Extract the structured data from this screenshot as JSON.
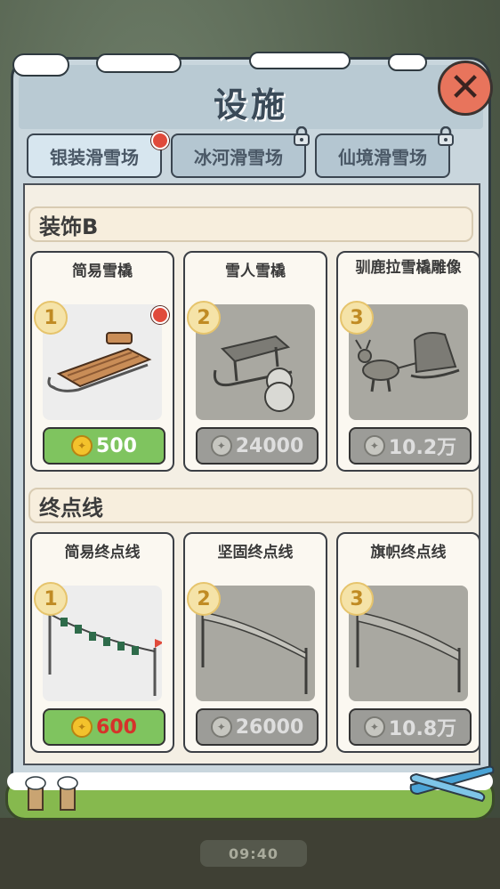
{
  "title": "设施",
  "tabs": [
    {
      "label": "银装滑雪场",
      "active": true,
      "badge": "red-dot"
    },
    {
      "label": "冰河滑雪场",
      "active": false,
      "badge": "lock"
    },
    {
      "label": "仙境滑雪场",
      "active": false,
      "badge": "lock"
    }
  ],
  "sections": [
    {
      "title": "装饰B",
      "items": [
        {
          "name": "简易雪橇",
          "level": "1",
          "price": "500",
          "coin": "gold",
          "state": "available",
          "new": true
        },
        {
          "name": "雪人雪橇",
          "level": "2",
          "price": "24000",
          "coin": "silver",
          "state": "locked"
        },
        {
          "name": "驯鹿拉雪橇雕像",
          "level": "3",
          "price": "10.2万",
          "coin": "silver",
          "state": "locked"
        }
      ]
    },
    {
      "title": "终点线",
      "items": [
        {
          "name": "简易终点线",
          "level": "1",
          "price": "600",
          "coin": "gold",
          "state": "available",
          "price_color": "red"
        },
        {
          "name": "坚固终点线",
          "level": "2",
          "price": "26000",
          "coin": "silver",
          "state": "locked"
        },
        {
          "name": "旗帜终点线",
          "level": "3",
          "price": "10.8万",
          "coin": "silver",
          "state": "locked"
        }
      ]
    }
  ],
  "clock": "09:40",
  "colors": {
    "accent_green": "#7fc45f",
    "close_red": "#e8745c",
    "badge_gold": "#f5e3a8"
  }
}
